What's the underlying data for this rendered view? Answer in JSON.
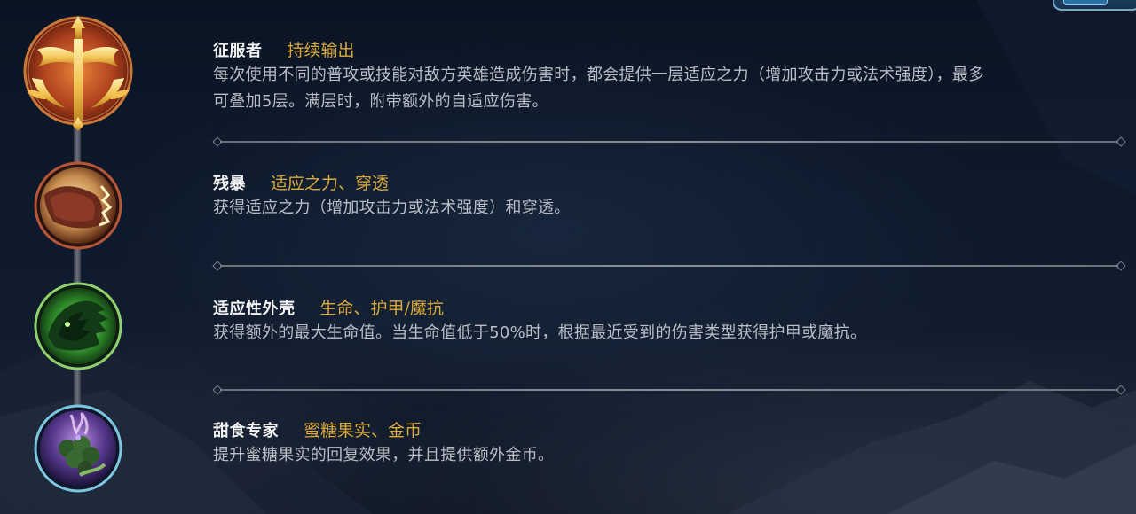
{
  "runes": [
    {
      "name": "征服者",
      "stats": "持续输出",
      "desc_lines": [
        "每次使用不同的普攻或技能对敌方英雄造成伤害时，都会提供一层适应之力（增加攻击力或法术强度），最多",
        "可叠加5层。满层时，附带额外的自适应伤害。"
      ],
      "icon": "conqueror-icon",
      "ring_color": "#b8553a"
    },
    {
      "name": "残暴",
      "stats": "适应之力、穿透",
      "desc_lines": [
        "获得适应之力（增加攻击力或法术强度）和穿透。"
      ],
      "icon": "brutal-icon",
      "ring_color": "#b8553a"
    },
    {
      "name": "适应性外壳",
      "stats": "生命、护甲/魔抗",
      "desc_lines": [
        "获得额外的最大生命值。当生命值低于50%时，根据最近受到的伤害类型获得护甲或魔抗。"
      ],
      "icon": "adaptive-shell-icon",
      "ring_color": "#6fc35a"
    },
    {
      "name": "甜食专家",
      "stats": "蜜糖果实、金币",
      "desc_lines": [
        "提升蜜糖果实的回复效果，并且提供额外金币。"
      ],
      "icon": "sweet-tooth-icon",
      "ring_color": "#5ab8d8"
    }
  ],
  "colors": {
    "name": "#f2f2f2",
    "stats": "#d9a93c",
    "description": "#b9bec6"
  }
}
